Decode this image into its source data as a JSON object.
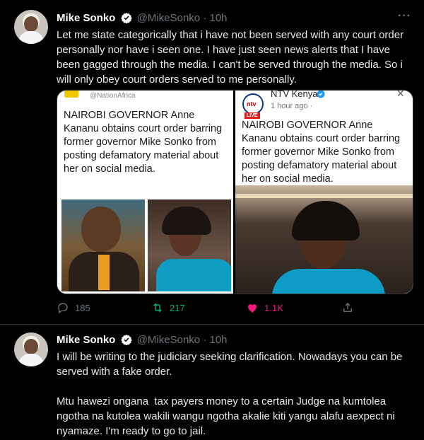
{
  "tweets": [
    {
      "name": "Mike Sonko",
      "handle": "@MikeSonko",
      "separator": "·",
      "time": "10h",
      "text": "Let me state categorically that i have not been served with any court order personally nor have i seen one. I have just seen news alerts that I have been gagged through the media. I can't be served through the media. So i will only obey court orders served to me personally.",
      "media": {
        "left": {
          "source": "@NationAfrica",
          "headline": "NAIROBI GOVERNOR Anne Kananu obtains court order barring former governor Mike Sonko from posting defamatory material about her on social media."
        },
        "right": {
          "channel": "NTV Kenya",
          "time": "1 hour ago · ",
          "live_badge": "LIVE",
          "headline": "NAIROBI GOVERNOR Anne Kananu obtains court order barring former governor Mike Sonko from posting defamatory material about her on social media."
        }
      },
      "replies": "185",
      "retweets": "217",
      "likes": "1.1K",
      "colors": {
        "retweet": "#00ba7c",
        "like": "#f91880"
      }
    },
    {
      "name": "Mike Sonko",
      "handle": "@MikeSonko",
      "separator": "·",
      "time": "10h",
      "text": "I will be writing to the judiciary seeking clarification. Nowadays you can be served with a fake order.\n\nMtu hawezi ongana  tax payers money to a certain Judge na kumtolea ngotha na kutolea wakili wangu ngotha akalie kiti yangu alafu aexpect ni nyamaze. I'm ready to go to jail."
    }
  ],
  "icons": [
    "verified-badge-icon",
    "more-icon",
    "reply-icon",
    "retweet-icon",
    "like-icon",
    "share-icon"
  ]
}
